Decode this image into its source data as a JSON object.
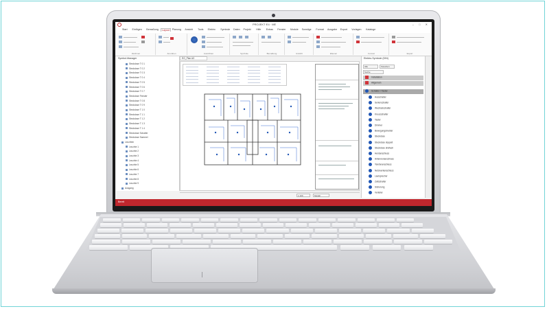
{
  "window": {
    "title": "PROJEKT·E4 · ME",
    "controls": "– □ ✕"
  },
  "menu": {
    "items": [
      "Start",
      "Einfügen",
      "Bemaßung",
      "Layout",
      "Planung",
      "Ansicht",
      "Tools",
      "Elektro",
      "Symbole",
      "Daten",
      "Projekt",
      "Hilfe",
      "Extras",
      "Fenster",
      "Module",
      "Sonstige",
      "Format",
      "Ausgabe",
      "Export",
      "Vorlagen",
      "Kataloge"
    ],
    "active_index": 3
  },
  "ribbon": {
    "groups": [
      "Zeichnen",
      "Anordnen",
      "Ausrichten",
      "Symbole",
      "Bemaßung",
      "Ansicht",
      "Ebenen",
      "Format",
      "Export"
    ]
  },
  "left_panel": {
    "title": "Symbol-Manager",
    "items": [
      "Steckdose T 0 1",
      "Steckdose T 0 2",
      "Steckdose T 0 3",
      "Steckdose T 0 4",
      "Steckdose T 0 5",
      "Steckdose T 0 6",
      "Steckdose T 0 7",
      "Steckdose Fenster",
      "Steckdose T 0 8",
      "Steckdose T 0 9",
      "Steckdose T 1 0",
      "Steckdose T 1 1",
      "Steckdose T 1 2",
      "Steckdose T 1 3",
      "Steckdose T 1 4",
      "Steckdose Schalter",
      "Steckdose Sammel",
      "Leuchten",
      "Leuchte 1",
      "Leuchte 2",
      "Leuchte 3",
      "Leuchte 4",
      "Leuchte 5",
      "Leuchte 6",
      "Leuchte 7",
      "Leuchte 8",
      "Leuchte 9",
      "Ausgang"
    ]
  },
  "drawing": {
    "tab_label": "EG_Plan A3",
    "status_fields": [
      "1:100",
      "Modell"
    ]
  },
  "right_panel": {
    "title": "Elektro-Symbole (DIN)",
    "tabs": [
      "Alle",
      "Favoriten"
    ],
    "filter_label": "Suche",
    "headers": [
      "Installation",
      "Allgemein"
    ],
    "section_label": "Schalter / Taster",
    "items": [
      "Ausschalter",
      "Serienschalter",
      "Wechselschalter",
      "Kreuzschalter",
      "Taster",
      "Dimmer",
      "Bewegungsmelder",
      "Steckdose",
      "Steckdose doppelt",
      "Steckdose dreifach",
      "Herdanschluss",
      "Antennenanschluss",
      "Telefonanschluss",
      "Netzwerkanschluss",
      "Lautsprecher",
      "Zeitschalter",
      "Sicherung",
      "Verteiler"
    ]
  },
  "statusbar": {
    "text": "Bereit"
  },
  "colors": {
    "brand": "#c0272d",
    "symbol_blue": "#2056b5"
  }
}
